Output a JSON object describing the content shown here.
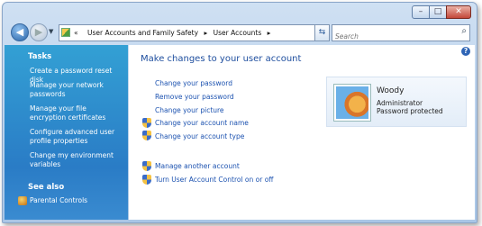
{
  "window": {
    "minimize_glyph": "–",
    "maximize_glyph": "□",
    "close_glyph": "✕"
  },
  "nav": {
    "back_glyph": "◀",
    "forward_glyph": "▶",
    "breadcrumb_lead": "«",
    "breadcrumb_sep": "▸",
    "breadcrumb": [
      "User Accounts and Family Safety",
      "User Accounts"
    ],
    "refresh_glyph": "⇆",
    "search_placeholder": "Search"
  },
  "sidebar": {
    "tasks_heading": "Tasks",
    "tasks": [
      "Create a password reset disk",
      "Manage your network passwords",
      "Manage your file encryption certificates",
      "Configure advanced user profile properties",
      "Change my environment variables"
    ],
    "see_also_heading": "See also",
    "see_also": [
      "Parental Controls"
    ]
  },
  "main": {
    "heading": "Make changes to your user account",
    "links": [
      "Change your password",
      "Remove your password",
      "Change your picture",
      "Change your account name",
      "Change your account type"
    ],
    "admin_links": [
      "Manage another account",
      "Turn User Account Control on or off"
    ]
  },
  "user": {
    "name": "Woody",
    "role": "Administrator",
    "status": "Password protected"
  }
}
